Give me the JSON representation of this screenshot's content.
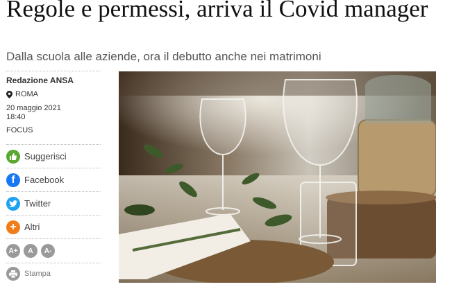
{
  "article": {
    "title": "Regole e permessi, arriva il Covid manager",
    "subtitle": "Dalla scuola alle aziende, ora il debutto anche nei matrimoni",
    "author": "Redazione ANSA",
    "location": "ROMA",
    "date": "20 maggio 2021",
    "time": "18:40",
    "section": "FOCUS"
  },
  "share": {
    "suggest": "Suggerisci",
    "facebook": "Facebook",
    "twitter": "Twitter",
    "others": "Altri"
  },
  "font_size": {
    "increase": "A+",
    "reset": "A",
    "decrease": "A-"
  },
  "print_label": "Stampa",
  "icons": [
    "pin-icon",
    "thumb-up-icon",
    "facebook-icon",
    "twitter-icon",
    "plus-icon",
    "print-icon"
  ],
  "colors": {
    "suggest": "#5aa832",
    "facebook": "#1877f2",
    "twitter": "#1da1f2",
    "others": "#f07d1a",
    "font_btn": "#9a9a9a"
  }
}
